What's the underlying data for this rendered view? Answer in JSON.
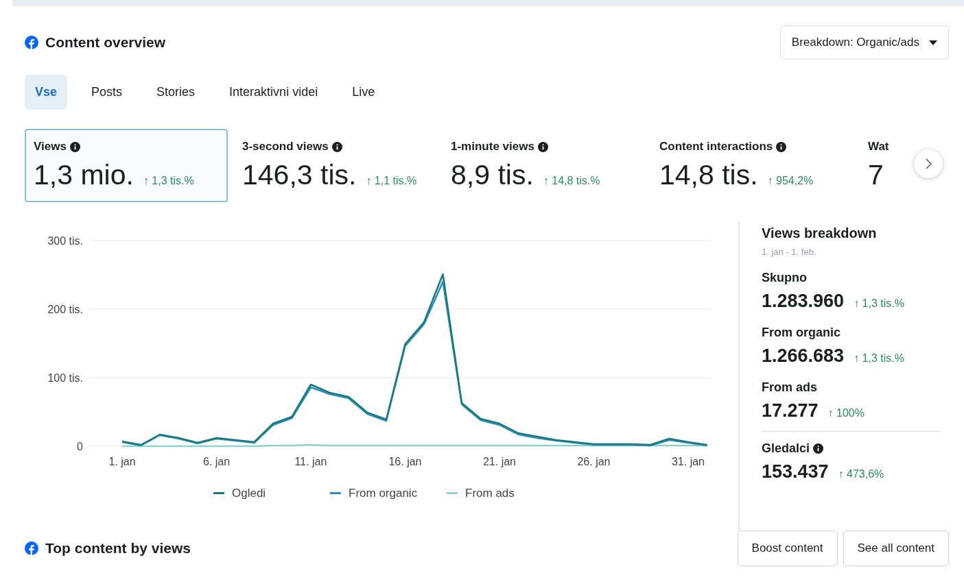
{
  "header": {
    "title": "Content overview",
    "breakdown": "Breakdown: Organic/ads"
  },
  "tabs": [
    {
      "label": "Vse",
      "selected": true
    },
    {
      "label": "Posts",
      "selected": false
    },
    {
      "label": "Stories",
      "selected": false
    },
    {
      "label": "Interaktivni videi",
      "selected": false
    },
    {
      "label": "Live",
      "selected": false
    }
  ],
  "metrics": [
    {
      "label": "Views",
      "value": "1,3 mio.",
      "change": "↑ 1,3 tis.%",
      "selected": true
    },
    {
      "label": "3-second views",
      "value": "146,3 tis.",
      "change": "↑ 1,1 tis.%",
      "selected": false
    },
    {
      "label": "1-minute views",
      "value": "8,9 tis.",
      "change": "↑ 14,8 tis.%",
      "selected": false
    },
    {
      "label": "Content interactions",
      "value": "14,8 tis.",
      "change": "↑ 954,2%",
      "selected": false
    },
    {
      "label": "Wat",
      "value": "7",
      "selected": false
    }
  ],
  "chart_data": {
    "type": "line",
    "legend": "bottom",
    "categories": [
      "1. jan",
      null,
      null,
      null,
      null,
      "6. jan",
      null,
      null,
      null,
      null,
      "11. jan",
      null,
      null,
      null,
      null,
      "16. jan",
      null,
      null,
      null,
      null,
      "21. jan",
      null,
      null,
      null,
      null,
      "26. jan",
      null,
      null,
      null,
      null,
      "31. jan",
      null
    ],
    "yticks": [
      {
        "value": 0,
        "label": "0"
      },
      {
        "value": 100,
        "label": "100 tis."
      },
      {
        "value": 200,
        "label": "200 tis."
      },
      {
        "value": 300,
        "label": "300 tis."
      }
    ],
    "ylim": [
      0,
      300
    ],
    "series": [
      {
        "name": "Ogledi",
        "color": "#1c7a78",
        "values": [
          7,
          2,
          17,
          12,
          5,
          12,
          9,
          6,
          33,
          43,
          90,
          78,
          72,
          49,
          39,
          149,
          181,
          251,
          63,
          40,
          33,
          19,
          14,
          9,
          6,
          3,
          3,
          3,
          2,
          11,
          6,
          2
        ]
      },
      {
        "name": "From organic",
        "color": "#2a8fc0",
        "values": [
          6,
          1,
          16,
          11,
          4,
          11,
          8,
          5,
          31,
          41,
          86,
          76,
          70,
          47,
          37,
          146,
          178,
          240,
          61,
          38,
          31,
          17,
          12,
          8,
          5,
          2,
          2,
          2,
          1,
          9,
          5,
          1
        ]
      },
      {
        "name": "From ads",
        "color": "#8fd3cf",
        "values": [
          0,
          0,
          0,
          0,
          0,
          0,
          0,
          0,
          1,
          1,
          2,
          1,
          1,
          1,
          1,
          1,
          1,
          1,
          1,
          1,
          1,
          1,
          1,
          1,
          1,
          1,
          1,
          1,
          1,
          1,
          1,
          1
        ]
      }
    ]
  },
  "breakdown": {
    "title": "Views breakdown",
    "range": "1. jan - 1. feb.",
    "items": [
      {
        "label": "Skupno",
        "value": "1.283.960",
        "change": "↑ 1,3 tis.%",
        "info": false
      },
      {
        "label": "From organic",
        "value": "1.266.683",
        "change": "↑ 1,3 tis.%",
        "info": false
      },
      {
        "label": "From ads",
        "value": "17.277",
        "change": "↑ 100%",
        "info": false
      },
      {
        "label": "Gledalci",
        "value": "153.437",
        "change": "↑ 473,6%",
        "info": true
      }
    ]
  },
  "top": {
    "title": "Top content by views",
    "buttons": [
      "Boost content",
      "See all content"
    ]
  }
}
